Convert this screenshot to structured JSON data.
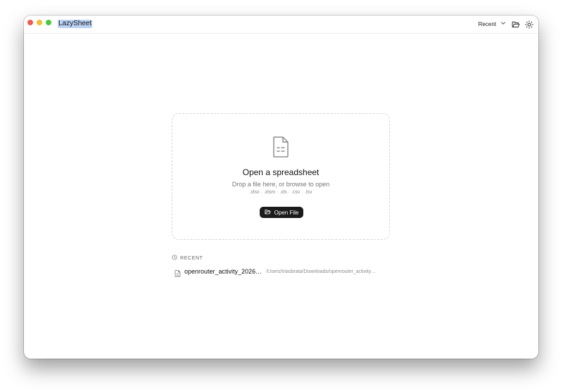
{
  "app": {
    "title": "LazySheet"
  },
  "toolbar": {
    "recent_label": "Recent",
    "recent_icon": "chevron-down-icon",
    "open_folder_icon": "folder-open-icon",
    "theme_icon": "sun-icon"
  },
  "dropzone": {
    "icon": "spreadsheet-file-icon",
    "title": "Open a spreadsheet",
    "subtitle": "Drop a file here, or browse to open",
    "file_types": ".xlsx · .xlsm · .xls · .csv · .tsv",
    "open_button_label": "Open File",
    "open_button_icon": "folder-open-icon"
  },
  "recent": {
    "header": "RECENT",
    "header_icon": "clock-icon",
    "items": [
      {
        "name": "openrouter_activity_2026…",
        "path": "/Users/triasbrata/Downloads/openrouter_activity…",
        "icon": "file-icon"
      }
    ]
  },
  "colors": {
    "close": "#f05c53",
    "minimize": "#f5be33",
    "maximize": "#4fc842",
    "button_bg": "#1b1b1b",
    "title_highlight": "#bcd3f6"
  }
}
